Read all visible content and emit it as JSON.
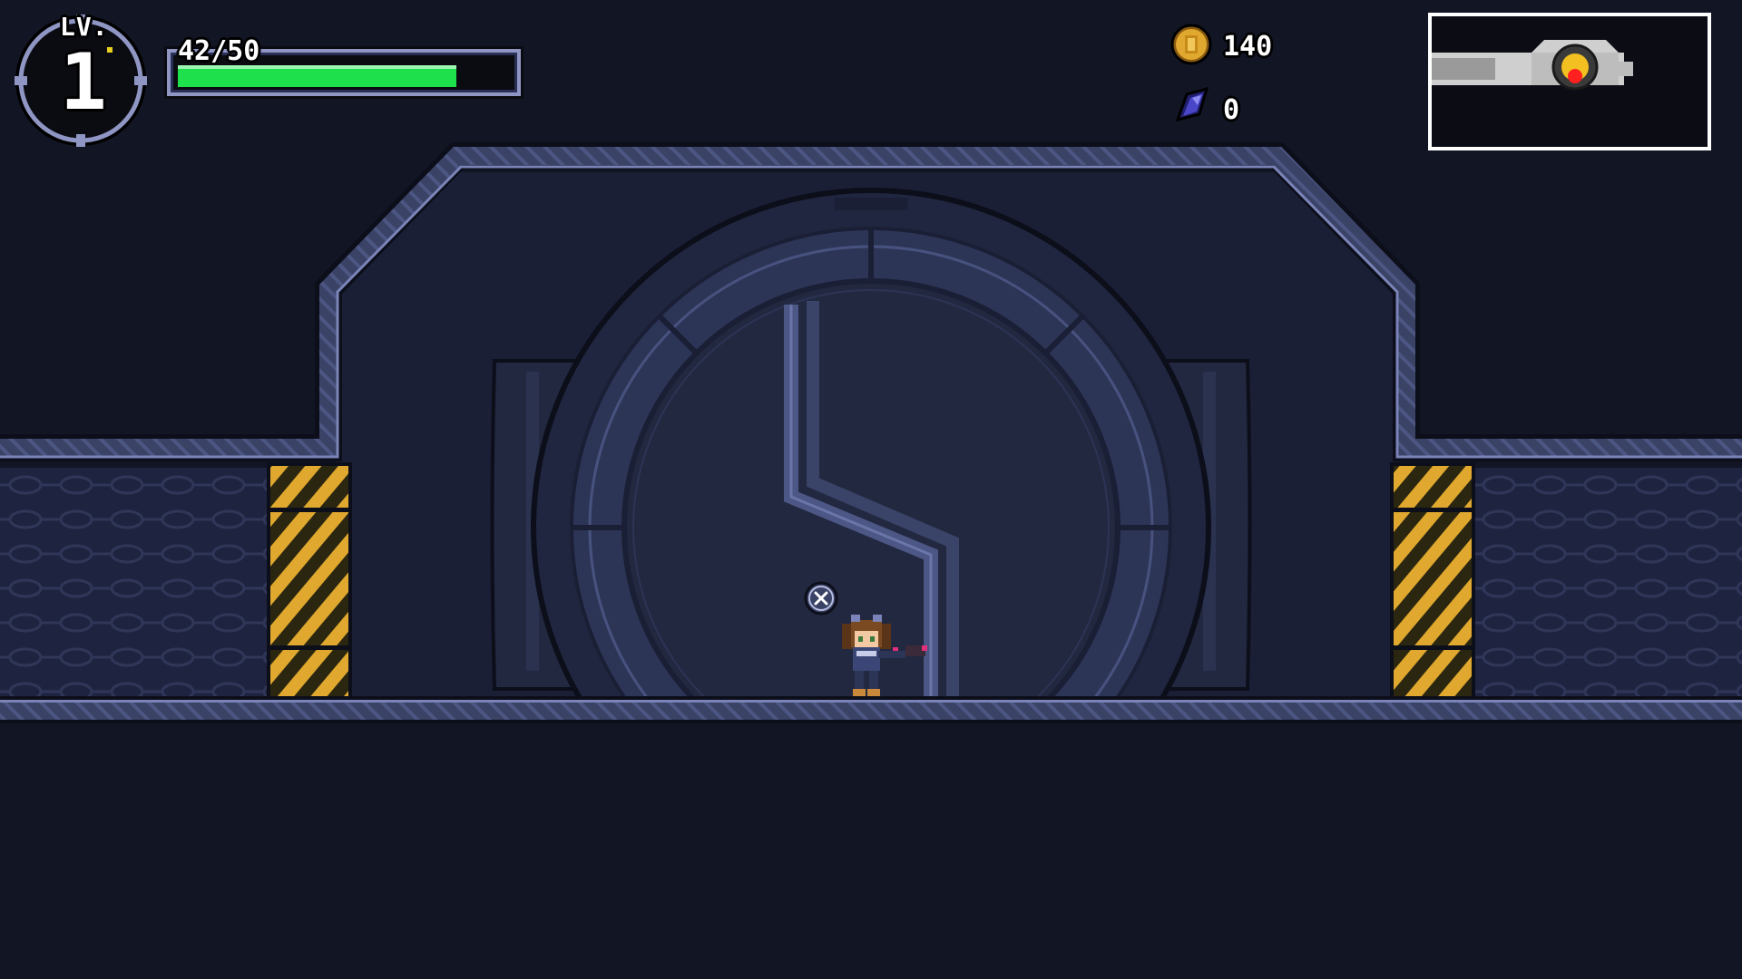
{
  "hud": {
    "level_label": "LV.",
    "level_value": "1",
    "hp": {
      "current": 42,
      "max": 50,
      "text": "42/50"
    },
    "coins": {
      "icon": "coin-icon",
      "count": "140"
    },
    "gems": {
      "icon": "gem-icon",
      "count": "0"
    }
  },
  "minimap": {
    "player_marker_color": "#ff2020",
    "room_color": "#cfcfcf"
  },
  "prompt": {
    "icon": "cross-button-icon"
  },
  "colors": {
    "background": "#121524",
    "wall": "#242a44",
    "hazard_yellow": "#e0a82e",
    "hp_green": "#1ee04c"
  }
}
